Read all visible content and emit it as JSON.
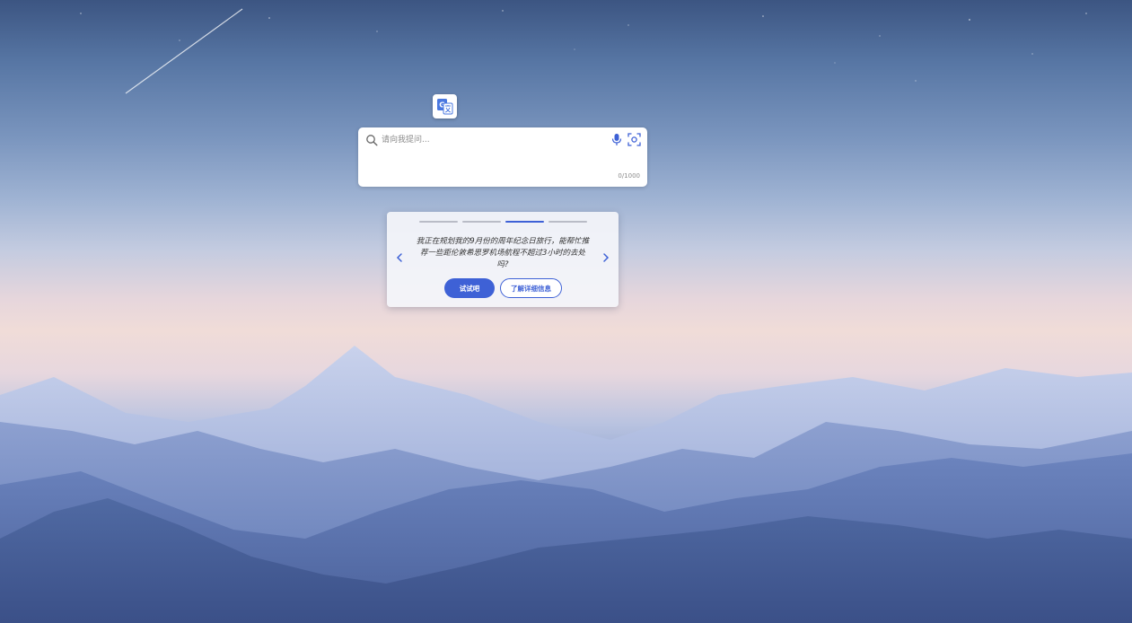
{
  "search": {
    "placeholder": "请向我提问...",
    "char_count": "0/1000"
  },
  "suggestion": {
    "prompt": "我正在规划我的9月份的周年纪念日旅行，能帮忙推荐一些距伦敦希思罗机场航程不超过3小时的去处吗?",
    "try_label": "试试吧",
    "more_label": "了解详细信息",
    "page_count": 4,
    "active_page": 3
  },
  "icons": {
    "app": "translate-icon",
    "search": "search-icon",
    "mic": "microphone-icon",
    "scan": "visual-search-icon",
    "prev": "chevron-left-icon",
    "next": "chevron-right-icon"
  },
  "colors": {
    "accent": "#3e61d6",
    "card_bg": "#f4f5fa"
  }
}
